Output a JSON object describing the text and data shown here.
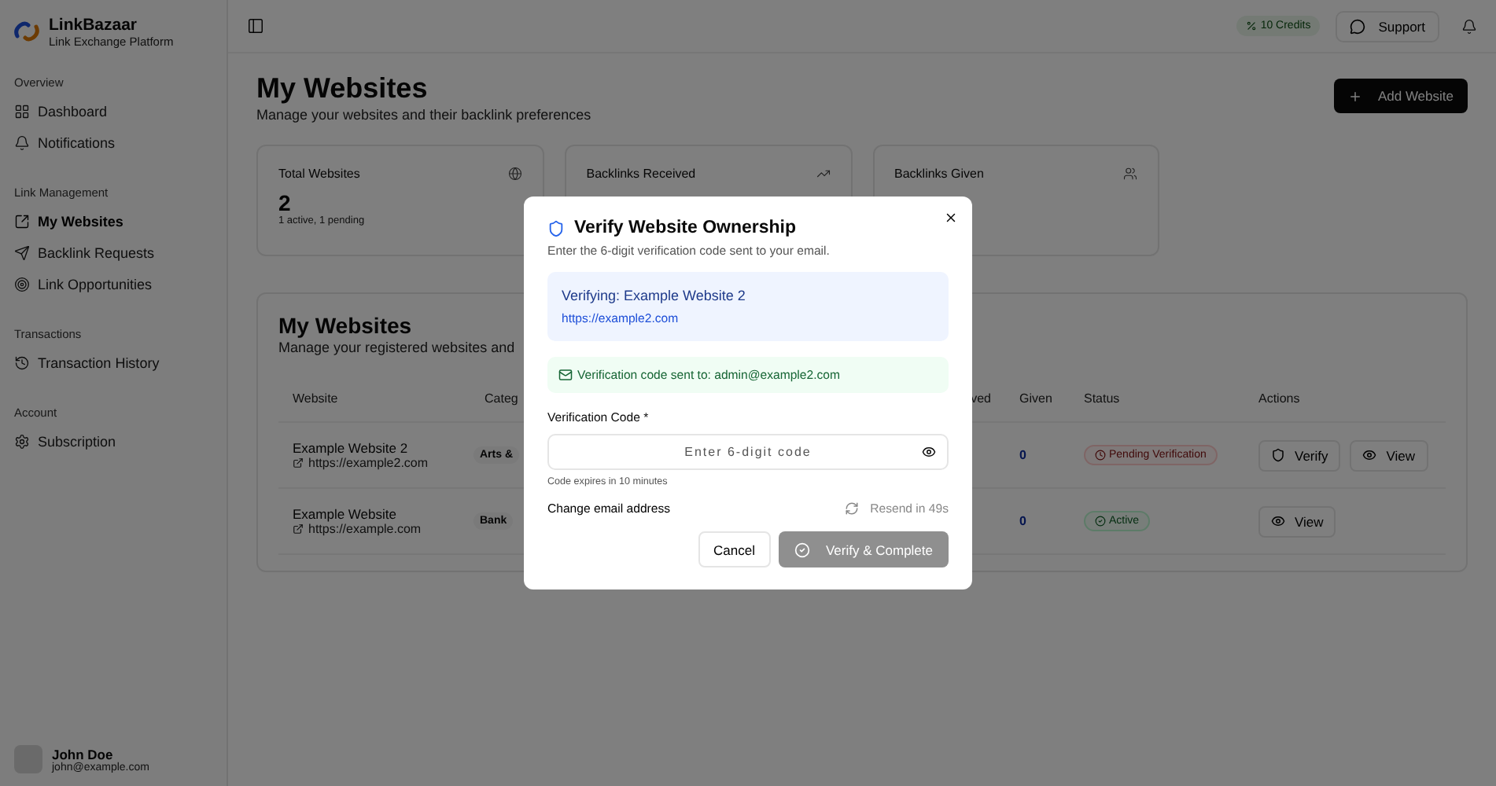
{
  "brand": {
    "name": "LinkBazaar",
    "tagline": "Link Exchange Platform"
  },
  "sidebar": {
    "groups": [
      {
        "label": "Overview",
        "items": [
          {
            "label": "Dashboard",
            "selected": false
          },
          {
            "label": "Notifications",
            "selected": false
          }
        ]
      },
      {
        "label": "Link Management",
        "items": [
          {
            "label": "My Websites",
            "selected": true
          },
          {
            "label": "Backlink Requests",
            "selected": false
          },
          {
            "label": "Link Opportunities",
            "selected": false
          }
        ]
      },
      {
        "label": "Transactions",
        "items": [
          {
            "label": "Transaction History",
            "selected": false
          }
        ]
      },
      {
        "label": "Account",
        "items": [
          {
            "label": "Subscription",
            "selected": false
          }
        ]
      }
    ],
    "user": {
      "name": "John Doe",
      "email": "john@example.com"
    }
  },
  "topbar": {
    "credits": "10 Credits",
    "support": "Support"
  },
  "page": {
    "title": "My Websites",
    "subtitle": "Manage your websites and their backlink preferences",
    "add_button": "Add Website"
  },
  "stats": [
    {
      "title": "Total Websites",
      "value": "2",
      "note": "1 active, 1 pending"
    },
    {
      "title": "Backlinks Received"
    },
    {
      "title": "Backlinks Given"
    }
  ],
  "table_card": {
    "title": "My Websites",
    "subtitle": "Manage your registered websites and",
    "columns": [
      "Website",
      "Categ",
      "ved",
      "Given",
      "Status",
      "Actions"
    ],
    "rows": [
      {
        "name": "Example Website 2",
        "url": "https://example2.com",
        "category": "Arts &",
        "given": "0",
        "status": {
          "kind": "pending",
          "label": "Pending Verification"
        },
        "actions": [
          {
            "kind": "verify",
            "label": "Verify"
          },
          {
            "kind": "view",
            "label": "View"
          }
        ]
      },
      {
        "name": "Example Website",
        "url": "https://example.com",
        "category": "Bank",
        "given": "0",
        "status": {
          "kind": "active",
          "label": "Active"
        },
        "actions": [
          {
            "kind": "view",
            "label": "View"
          }
        ]
      }
    ]
  },
  "dialog": {
    "title": "Verify Website Ownership",
    "description": "Enter the 6-digit verification code sent to your email.",
    "site_name": "Verifying: Example Website 2",
    "site_url": "https://example2.com",
    "notice": "Verification code sent to: admin@example2.com",
    "field_label": "Verification Code *",
    "placeholder": "Enter 6-digit code",
    "hint": "Code expires in 10 minutes",
    "change_email": "Change email address",
    "resend": "Resend in 49s",
    "cancel": "Cancel",
    "confirm": {
      "label": "Verify & Complete",
      "disabled": true
    }
  }
}
